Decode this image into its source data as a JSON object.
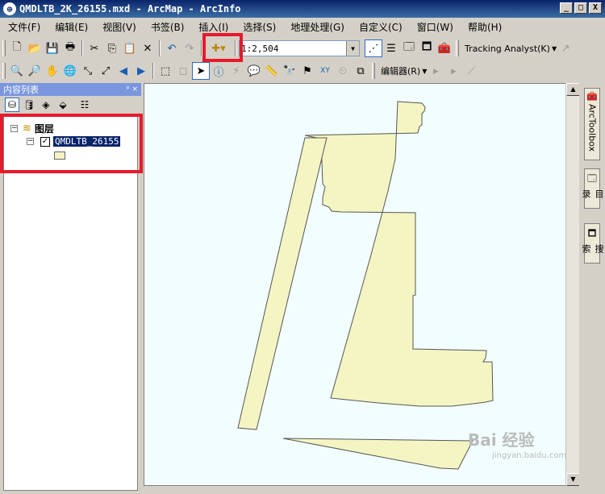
{
  "window": {
    "title": "QMDLTB_2K_26155.mxd - ArcMap - ArcInfo",
    "minimize": "_",
    "maximize": "□",
    "close": "X"
  },
  "menu": [
    "文件(F)",
    "编辑(E)",
    "视图(V)",
    "书签(B)",
    "插入(I)",
    "选择(S)",
    "地理处理(G)",
    "自定义(C)",
    "窗口(W)",
    "帮助(H)"
  ],
  "toolbar": {
    "scale_value": "1:2,504",
    "tracking_analyst_label": "Tracking Analyst(K)",
    "editor_label": "编辑器(R)"
  },
  "toc": {
    "title": "内容列表",
    "pin": "ᵖ ×",
    "group_label": "图层",
    "layer_name": "QMDLTB_26155",
    "layer_checked": "✓",
    "expander_collapse": "−"
  },
  "right_dock": {
    "arctoolbox": "ArcToolbox",
    "catalog": "目录",
    "search": "搜索"
  },
  "colors": {
    "highlight_box": "#e8192c",
    "polygon_fill": "#f5f5c4",
    "map_bg": "#f2fefe"
  },
  "watermark": {
    "main": "Bai 经验",
    "sub": "jingyan.baidu.com"
  }
}
